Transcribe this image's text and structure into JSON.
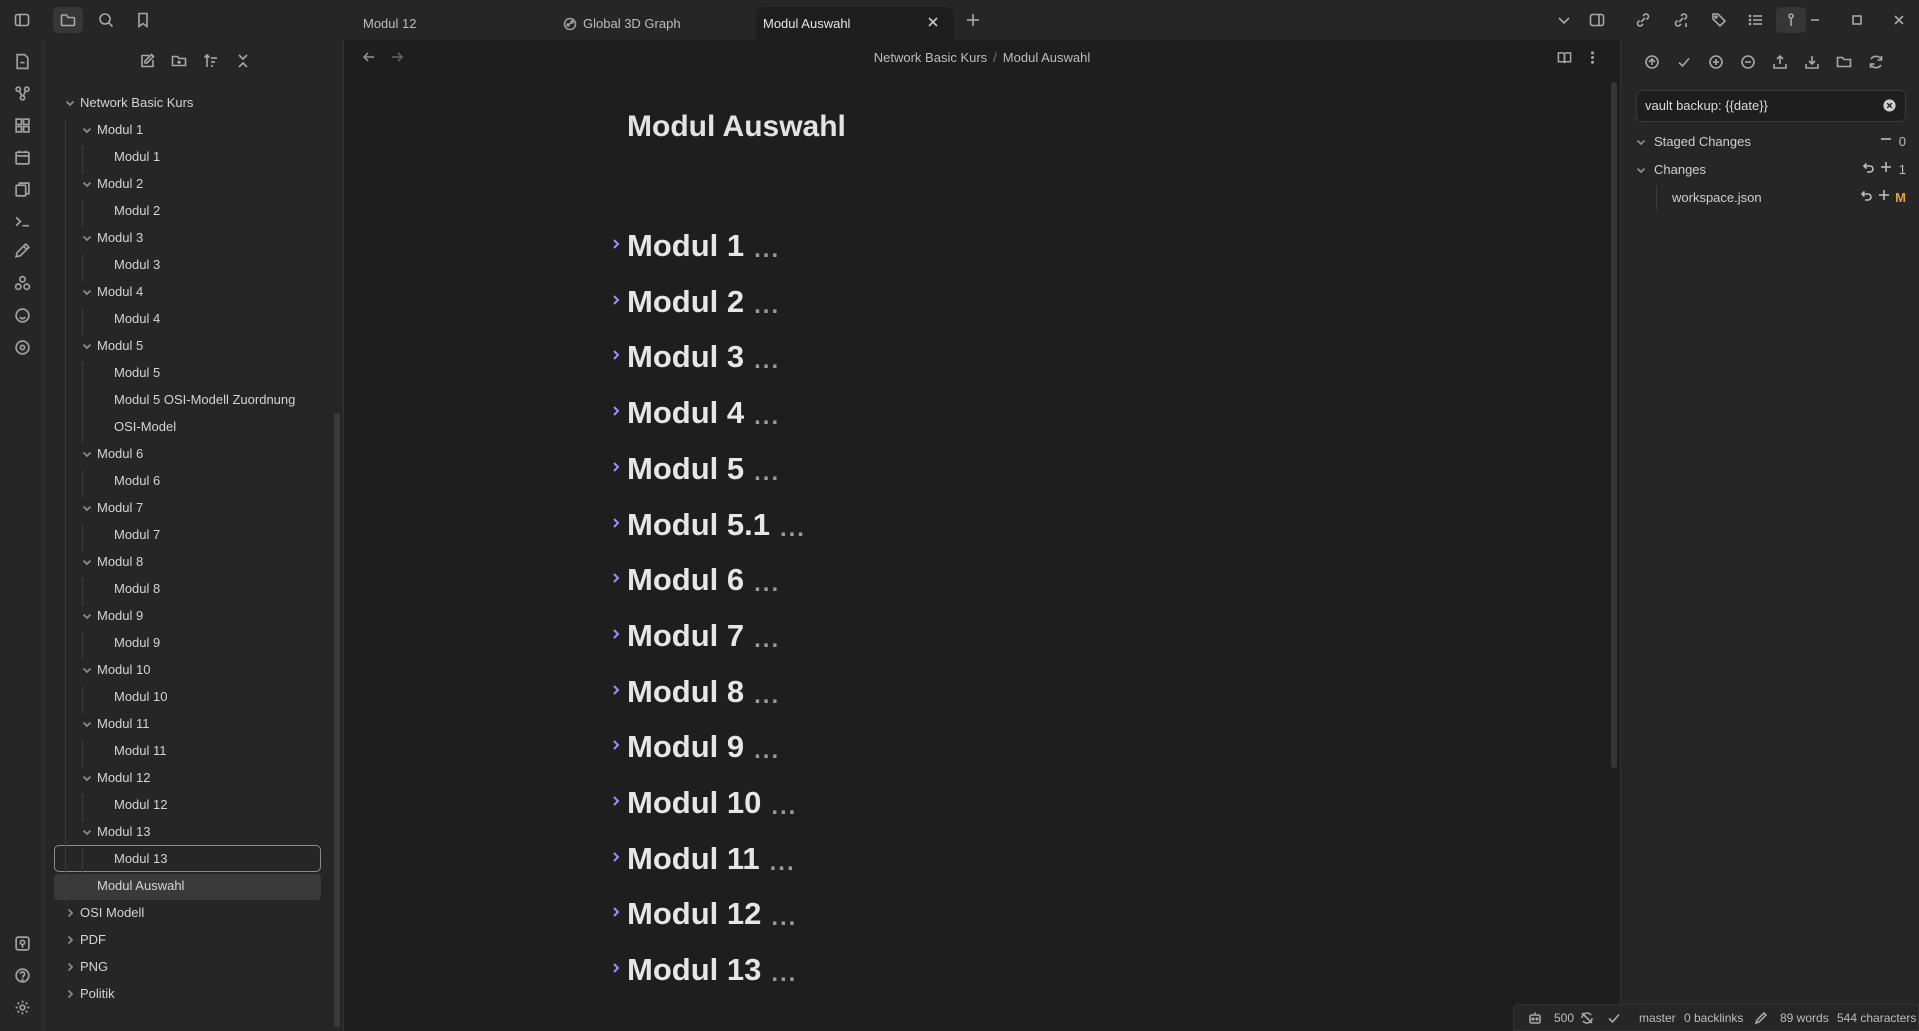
{
  "tabs": [
    {
      "label": "Modul 12"
    },
    {
      "label": "Global 3D Graph"
    },
    {
      "label": "Modul Auswahl"
    }
  ],
  "breadcrumb": {
    "parent": "Network Basic Kurs",
    "separator": "/",
    "current": "Modul Auswahl"
  },
  "document": {
    "title": "Modul Auswahl",
    "ellipsis": "...",
    "headings": [
      "Modul 1",
      "Modul 2",
      "Modul 3",
      "Modul 4",
      "Modul 5",
      "Modul 5.1",
      "Modul 6",
      "Modul 7",
      "Modul 8",
      "Modul 9",
      "Modul 10",
      "Modul 11",
      "Modul 12",
      "Modul 13"
    ]
  },
  "file_tree": {
    "root": "Network Basic Kurs",
    "folders": [
      {
        "name": "Modul 1",
        "files": [
          "Modul 1"
        ]
      },
      {
        "name": "Modul 2",
        "files": [
          "Modul 2"
        ]
      },
      {
        "name": "Modul 3",
        "files": [
          "Modul 3"
        ]
      },
      {
        "name": "Modul 4",
        "files": [
          "Modul 4"
        ]
      },
      {
        "name": "Modul 5",
        "files": [
          "Modul 5",
          "Modul 5 OSI-Modell Zuordnung",
          "OSI-Model"
        ]
      },
      {
        "name": "Modul 6",
        "files": [
          "Modul 6"
        ]
      },
      {
        "name": "Modul 7",
        "files": [
          "Modul 7"
        ]
      },
      {
        "name": "Modul 8",
        "files": [
          "Modul 8"
        ]
      },
      {
        "name": "Modul 9",
        "files": [
          "Modul 9"
        ]
      },
      {
        "name": "Modul 10",
        "files": [
          "Modul 10"
        ]
      },
      {
        "name": "Modul 11",
        "files": [
          "Modul 11"
        ]
      },
      {
        "name": "Modul 12",
        "files": [
          "Modul 12"
        ]
      },
      {
        "name": "Modul 13",
        "files": [
          "Modul 13"
        ]
      }
    ],
    "root_file": "Modul Auswahl",
    "other_folders": [
      "OSI Modell",
      "PDF",
      "PNG",
      "Politik"
    ]
  },
  "git": {
    "commit_message": "vault backup: {{date}}",
    "staged_label": "Staged Changes",
    "staged_count": "0",
    "changes_label": "Changes",
    "changes_count": "1",
    "changed_files": [
      {
        "name": "workspace.json",
        "status": "M"
      }
    ]
  },
  "status_bar": {
    "sync_count": "500",
    "branch": "master",
    "backlinks": "0 backlinks",
    "words": "89 words",
    "characters": "544 characters"
  },
  "colors": {
    "accent": "#a78bfa",
    "modified": "#e8a03b",
    "background": "#1e1e1e",
    "panel": "#262626"
  }
}
